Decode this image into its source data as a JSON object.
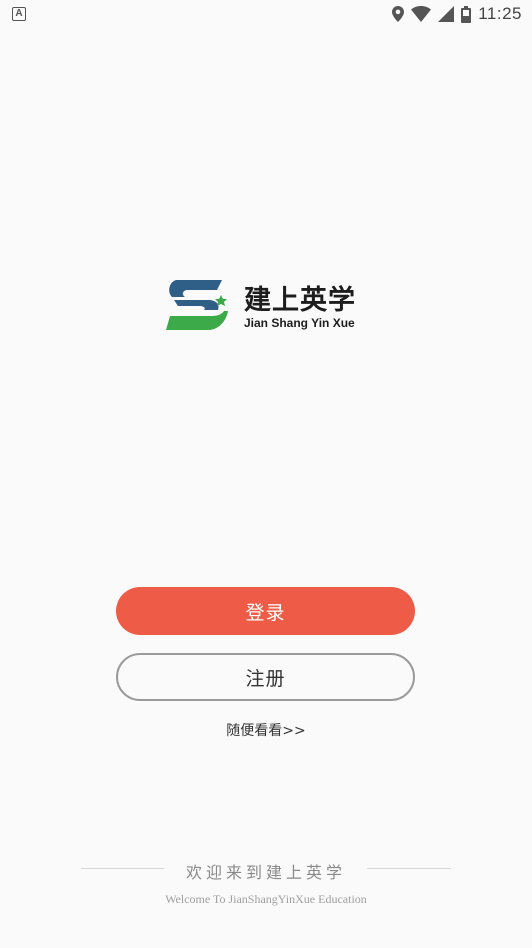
{
  "status_bar": {
    "notification_label": "A",
    "time": "11:25",
    "icons": [
      "location-icon",
      "wifi-icon",
      "signal-icon",
      "battery-icon"
    ]
  },
  "logo": {
    "name_cn": "建上英学",
    "name_en": "Jian Shang Yin Xue",
    "colors": {
      "blue": "#2f5f86",
      "green": "#3daa4a"
    }
  },
  "actions": {
    "login_label": "登录",
    "register_label": "注册",
    "browse_label": "随便看看>>"
  },
  "footer": {
    "welcome_cn": "欢迎来到建上英学",
    "welcome_en": "Welcome To JianShangYinXue Education"
  },
  "colors": {
    "primary": "#ee5c47",
    "background": "#fafafa"
  }
}
